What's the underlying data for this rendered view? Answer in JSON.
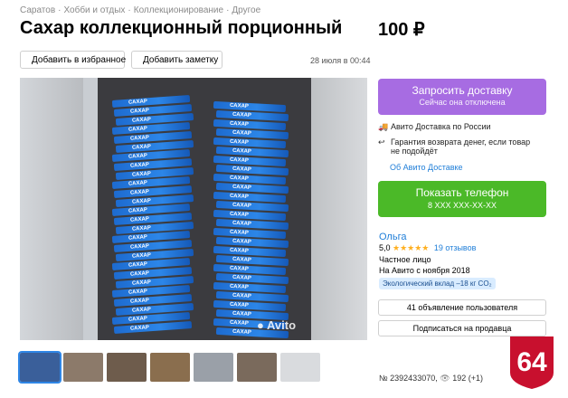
{
  "breadcrumbs": [
    "Саратов",
    "Хобби и отдых",
    "Коллекционирование",
    "Другое"
  ],
  "title": "Сахар коллекционный порционный",
  "price": "100 ₽",
  "actions": {
    "favorite_label": "Добавить в избранное",
    "note_label": "Добавить заметку"
  },
  "date": "28 июля в 00:44",
  "photo": {
    "watermark": "Avito",
    "stick_label": "САХАР"
  },
  "thumbnails": [
    {
      "color": "#3a5f9a",
      "selected": true
    },
    {
      "color": "#8c7a6a",
      "selected": false
    },
    {
      "color": "#6e5c4c",
      "selected": false
    },
    {
      "color": "#8a6e4e",
      "selected": false
    },
    {
      "color": "#9aa0a8",
      "selected": false
    },
    {
      "color": "#7a6a5c",
      "selected": false
    },
    {
      "color": "#d9dbde",
      "selected": false
    }
  ],
  "delivery_button": {
    "label": "Запросить доставку",
    "sublabel": "Сейчас она отключена",
    "color": "#a76ce2"
  },
  "delivery_info": {
    "line1": "Авито Доставка по России",
    "line2": "Гарантия возврата денег, если товар",
    "line3": "не подойдёт",
    "about_link": "Об Авито Доставке"
  },
  "phone_button": {
    "label": "Показать телефон",
    "sublabel": "8 XXX XXX-XX-XX",
    "color": "#4bb928"
  },
  "seller": {
    "name": "Ольга",
    "rating": "5,0",
    "stars": "★★★★★",
    "reviews": "19 отзывов",
    "type": "Частное лицо",
    "since": "На Авито с ноября 2018",
    "eco_badge": "Экологический вклад –18 кг CO₂"
  },
  "seller_buttons": {
    "ads_label": "41 объявление пользователя",
    "subscribe_label": "Подписаться на продавца"
  },
  "meta": {
    "listing_id": "№ 2392433070,",
    "views": "192 (+1)"
  },
  "logo_text": "64",
  "colors": {
    "link": "#1f7ed8",
    "logo": "#c8102e"
  }
}
